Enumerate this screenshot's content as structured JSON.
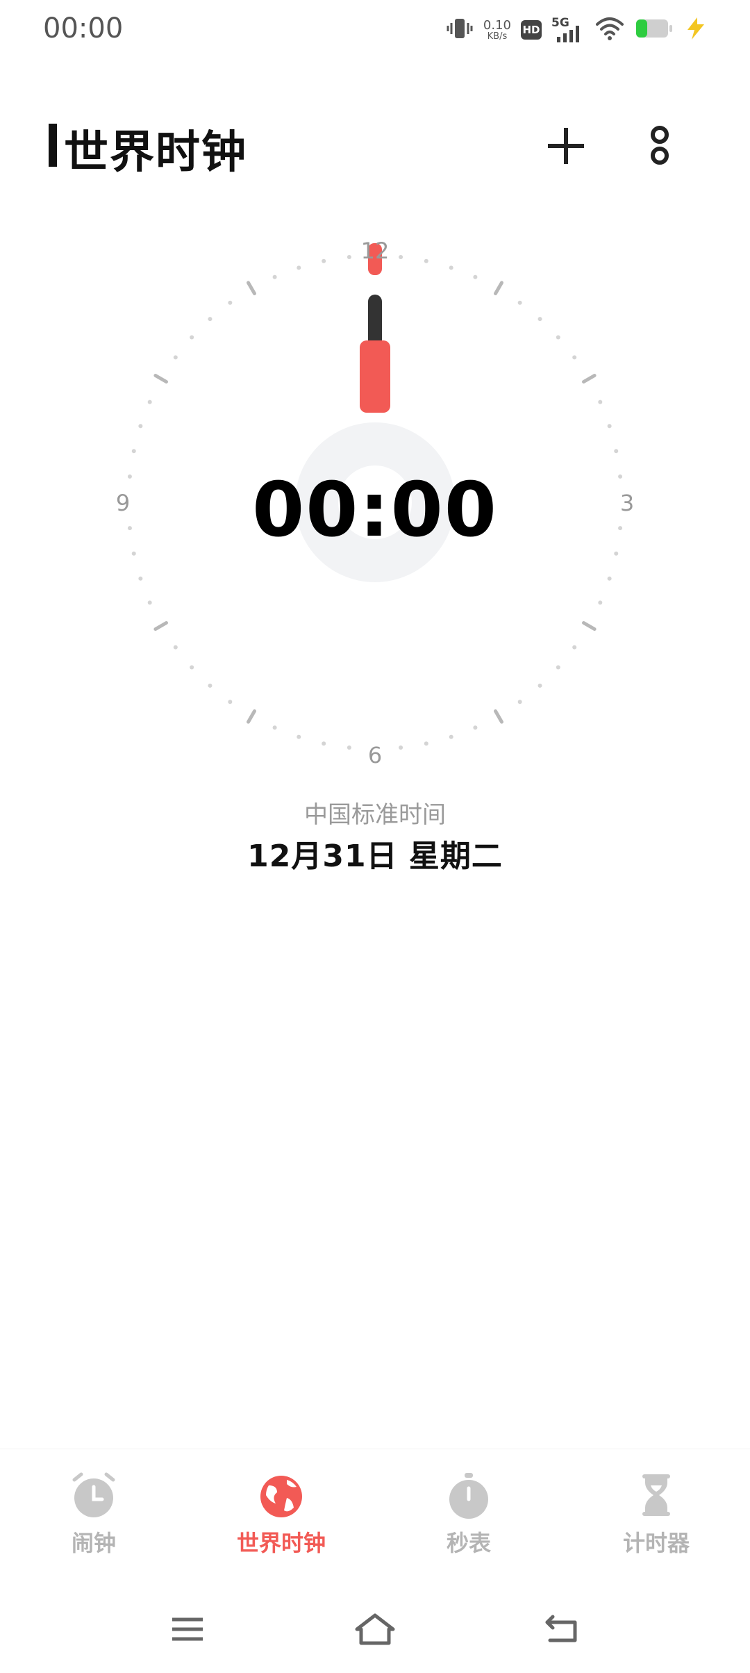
{
  "status_bar": {
    "time": "00:00",
    "net_speed_value": "0.10",
    "net_speed_unit": "KB/s",
    "hd_label": "HD",
    "network_label": "5G",
    "icons": [
      "vibrate-icon",
      "hd-icon",
      "5g-signal-icon",
      "wifi-icon",
      "battery-icon",
      "charging-icon"
    ]
  },
  "header": {
    "title": "世界时钟",
    "add_icon": "plus-icon",
    "more_icon": "more-dots-icon"
  },
  "clock": {
    "digital_time": "00:00",
    "dial_labels": {
      "top": "12",
      "right": "3",
      "bottom": "6",
      "left": "9"
    },
    "hour_hand_color": "#f25a55",
    "minute_hand_color": "#333333"
  },
  "timezone": {
    "name": "中国标准时间",
    "date": "12月31日  星期二"
  },
  "tabs": [
    {
      "label": "闹钟",
      "icon": "alarm-clock-icon",
      "active": false
    },
    {
      "label": "世界时钟",
      "icon": "globe-icon",
      "active": true
    },
    {
      "label": "秒表",
      "icon": "stopwatch-icon",
      "active": false
    },
    {
      "label": "计时器",
      "icon": "hourglass-icon",
      "active": false
    }
  ],
  "colors": {
    "accent": "#f25a55",
    "inactive": "#b4b4b4",
    "text": "#111111"
  },
  "nav_bar": {
    "icons": [
      "menu-icon",
      "home-icon",
      "back-icon"
    ]
  }
}
